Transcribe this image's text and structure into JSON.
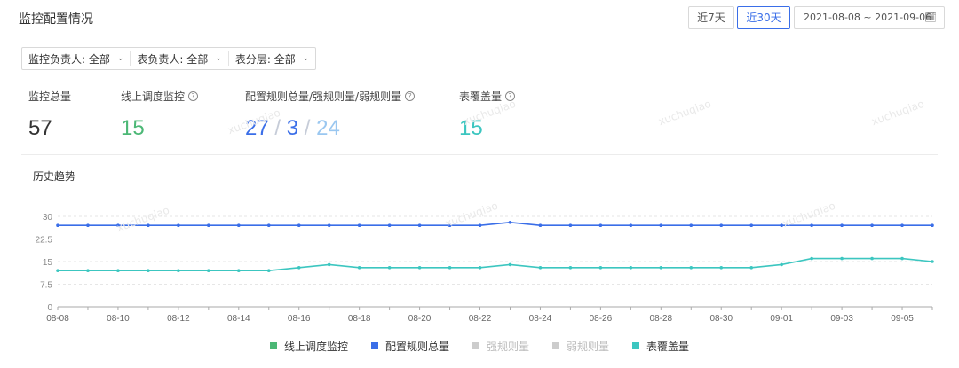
{
  "header": {
    "title": "监控配置情况",
    "range_buttons": [
      {
        "label": "近7天",
        "active": false
      },
      {
        "label": "近30天",
        "active": true
      }
    ],
    "date_range": "2021-08-08 ~ 2021-09-06",
    "date_icon": "calendar-icon"
  },
  "filters": [
    {
      "label": "监控负责人: 全部"
    },
    {
      "label": "表负责人: 全部"
    },
    {
      "label": "表分层: 全部"
    }
  ],
  "stats": {
    "total": {
      "label": "监控总量",
      "value": "57",
      "color": "#333333"
    },
    "online": {
      "label": "线上调度监控",
      "value": "15",
      "color": "#4cb876"
    },
    "rules": {
      "label": "配置规则总量/强规则量/弱规则量",
      "total": "27",
      "strong": "3",
      "weak": "24",
      "sep": "/",
      "colors": {
        "total": "#3a6ee8",
        "strong": "#3a6ee8",
        "weak": "#9ac7f0"
      }
    },
    "coverage": {
      "label": "表覆盖量",
      "value": "15",
      "color": "#3cc6c0"
    }
  },
  "trend": {
    "title": "历史趋势"
  },
  "watermark": "xuchuqiao",
  "chart_data": {
    "type": "line",
    "x": [
      "08-08",
      "08-09",
      "08-10",
      "08-11",
      "08-12",
      "08-13",
      "08-14",
      "08-15",
      "08-16",
      "08-17",
      "08-18",
      "08-19",
      "08-20",
      "08-21",
      "08-22",
      "08-23",
      "08-24",
      "08-25",
      "08-26",
      "08-27",
      "08-28",
      "08-29",
      "08-30",
      "08-31",
      "09-01",
      "09-02",
      "09-03",
      "09-04",
      "09-05",
      "09-06"
    ],
    "xtick_labels": [
      "08-08",
      "08-10",
      "08-12",
      "08-14",
      "08-16",
      "08-18",
      "08-20",
      "08-22",
      "08-24",
      "08-26",
      "08-28",
      "08-30",
      "09-01",
      "09-03",
      "09-05"
    ],
    "yticks": [
      "0",
      "7.5",
      "15",
      "22.5",
      "30"
    ],
    "ylim": [
      0,
      30
    ],
    "series": [
      {
        "name": "线上调度监控",
        "color": "#4cb876",
        "visible": false,
        "values": []
      },
      {
        "name": "配置规则总量",
        "color": "#3a6ee8",
        "visible": true,
        "values": [
          27,
          27,
          27,
          27,
          27,
          27,
          27,
          27,
          27,
          27,
          27,
          27,
          27,
          27,
          27,
          28,
          27,
          27,
          27,
          27,
          27,
          27,
          27,
          27,
          27,
          27,
          27,
          27,
          27,
          27
        ]
      },
      {
        "name": "强规则量",
        "color": "#cccccc",
        "visible": false,
        "values": []
      },
      {
        "name": "弱规则量",
        "color": "#cccccc",
        "visible": false,
        "values": []
      },
      {
        "name": "表覆盖量",
        "color": "#3cc6c0",
        "visible": true,
        "values": [
          12,
          12,
          12,
          12,
          12,
          12,
          12,
          12,
          13,
          14,
          13,
          13,
          13,
          13,
          13,
          14,
          13,
          13,
          13,
          13,
          13,
          13,
          13,
          13,
          14,
          16,
          16,
          16,
          16,
          15
        ]
      }
    ]
  }
}
